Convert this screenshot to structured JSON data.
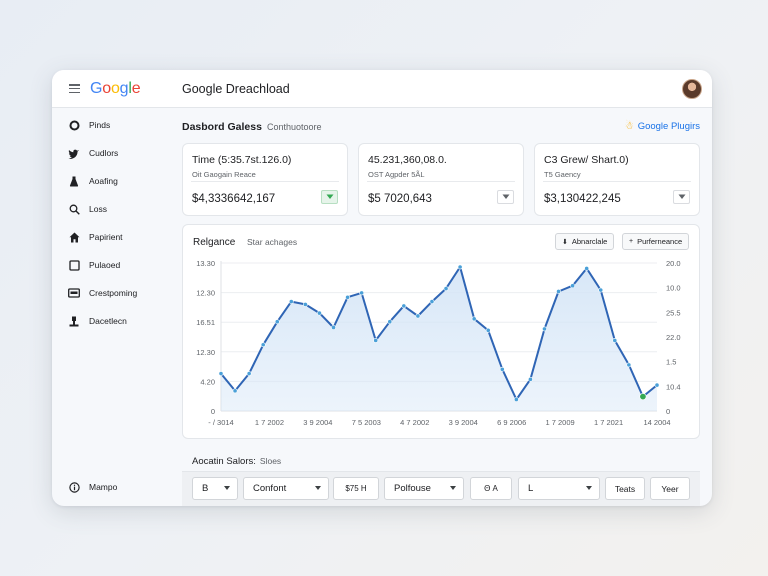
{
  "app": {
    "logo": "Google",
    "title": "Google Dreachload",
    "logo_colors": [
      "#4285F4",
      "#EA4335",
      "#FBBC05",
      "#4285F4",
      "#34A853",
      "#EA4335"
    ]
  },
  "sidebar": {
    "items": [
      {
        "label": "Pinds",
        "icon": "circle-icon"
      },
      {
        "label": "Cudlors",
        "icon": "bird-icon"
      },
      {
        "label": "Aoafing",
        "icon": "flask-icon"
      },
      {
        "label": "Loss",
        "icon": "search-icon"
      },
      {
        "label": "Papirient",
        "icon": "home-icon"
      },
      {
        "label": "Pulaoed",
        "icon": "square-icon"
      },
      {
        "label": "Crestpoming",
        "icon": "card-icon"
      },
      {
        "label": "Dacetlecn",
        "icon": "person-icon"
      }
    ],
    "footer": {
      "label": "Mampo",
      "icon": "info-icon"
    }
  },
  "header": {
    "title": "Dasbord Galess",
    "subtitle": "Conthuotoore",
    "plugins_label": "Google Plugirs"
  },
  "cards": [
    {
      "title": "Time (5:35.7st.126.0)",
      "sub": "Oit Gaogain Reace",
      "value": "$4,3336642,167",
      "dropdown_green": true
    },
    {
      "title": "45.231,360,08.0.",
      "sub": "OST Agpder 5ÃL",
      "value": "$5 7020,643",
      "dropdown_green": false
    },
    {
      "title": "C3 Grew/ Shart.0)",
      "sub": "T5 Gaency",
      "value": "$3,130422,245",
      "dropdown_green": false
    }
  ],
  "chart_panel": {
    "title": "Relgance",
    "subtitle": "Star achages",
    "button1": "Abnarclale",
    "button2": "Purferneance",
    "button1_icon": "download-icon",
    "button2_icon": "plus-icon"
  },
  "chart_data": {
    "type": "area",
    "y_left_ticks": [
      "13.30",
      "12.30",
      "16.51",
      "12.30",
      "4.20",
      "0"
    ],
    "y_right_ticks": [
      "20.0",
      "10.0",
      "25.5",
      "22.0",
      "1.5",
      "10.4",
      "0"
    ],
    "x_ticks": [
      "- / 3014",
      "1 7 2002",
      "3 9 2004",
      "7 5 2003",
      "4 7 2002",
      "3 9 2004",
      "6 9 2006",
      "1 7 2009",
      "1 7 2021",
      "14 2004"
    ],
    "series": [
      {
        "values": [
          0.26,
          0.14,
          0.26,
          0.46,
          0.62,
          0.76,
          0.74,
          0.68,
          0.58,
          0.79,
          0.82,
          0.49,
          0.62,
          0.73,
          0.66,
          0.76,
          0.85,
          1.0,
          0.64,
          0.56,
          0.29,
          0.08,
          0.22,
          0.57,
          0.83,
          0.87,
          0.99,
          0.84,
          0.49,
          0.32,
          0.1,
          0.18
        ]
      }
    ],
    "y_range": [
      0,
      1
    ],
    "grid": true,
    "line_color": "#2f65b5",
    "fill_color": "#d6e6f7",
    "marker_color": "#4aa0d8",
    "last_marker_color": "#34a853"
  },
  "bottom": {
    "title": "Aocatin Salors:",
    "subtitle": "Sloes",
    "toolbar": [
      {
        "label": "B",
        "caret": true
      },
      {
        "label": "Confont",
        "caret": true
      },
      {
        "label": "$75 H",
        "caret": false
      },
      {
        "label": "Polfouse",
        "caret": true
      },
      {
        "label": "Θ A",
        "caret": false
      },
      {
        "label": "L",
        "caret": true
      },
      {
        "label": "Teats",
        "caret": false
      },
      {
        "label": "Yeer",
        "caret": false
      }
    ]
  }
}
